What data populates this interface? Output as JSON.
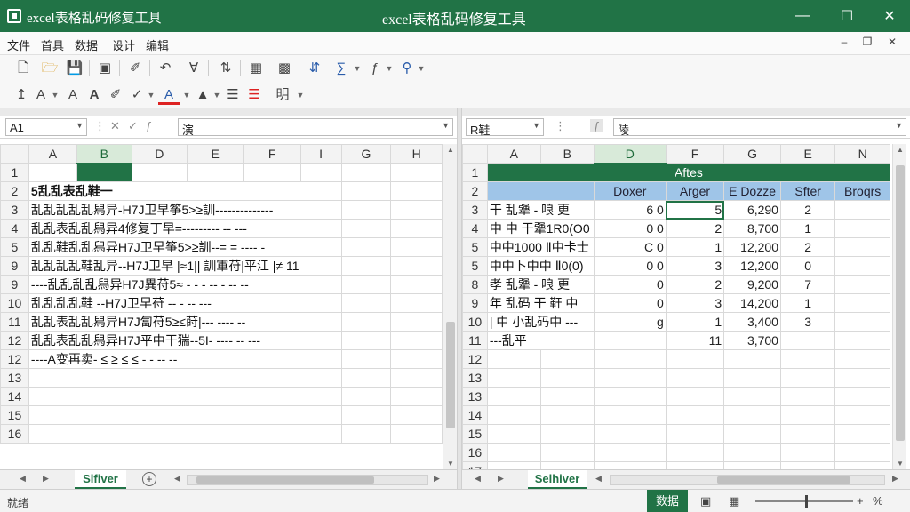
{
  "window": {
    "app_name": "excel表格乱码修复工具",
    "title": "excel表格乱码修复工具",
    "minimize_icon": "minimize-icon",
    "maximize_icon": "maximize-icon",
    "close_icon": "close-icon"
  },
  "menu": {
    "items": [
      "文件",
      "首具",
      "数据",
      "设计",
      "编辑"
    ]
  },
  "toolbar1": {
    "icons": [
      "new-file-icon",
      "open-folder-icon",
      "save-icon",
      "print-icon",
      "brush-icon",
      "undo-icon",
      "filter-icon",
      "sort-icon",
      "table-icon",
      "grid-icon",
      "sort-desc-icon",
      "function-icon",
      "zoom-icon"
    ]
  },
  "toolbar2": {
    "icons": [
      "indent-icon",
      "font-size-icon",
      "underline-a-icon",
      "bold-a-icon",
      "highlight-icon",
      "strike-icon",
      "font-color-icon",
      "fill-icon",
      "align-icon",
      "list-icon",
      "merge-icon"
    ],
    "merge_label": "明"
  },
  "left": {
    "name_box": "A1",
    "fx_label": "演",
    "columns": [
      "A",
      "B",
      "D",
      "E",
      "F",
      "I",
      "G",
      "H"
    ],
    "selected_column": "B",
    "row_numbers": [
      "1",
      "2",
      "3",
      "4",
      "5",
      "9",
      "9",
      "10",
      "11",
      "12",
      "12",
      "13",
      "14",
      "15",
      "16"
    ],
    "row_texts": [
      "",
      "5乱乱表乱鞋一",
      "乱乱乱乱乱舄异-H7J卫早筝5>≥訓--------------",
      "乱乱表乱乱舄异4修复丁早=--------- -- ---",
      "乱乱鞋乱乱舄异H7J卫早筝5>≥訓--= = ---- -",
      "乱乱乱乱鞋乱异--H7J卫早 |≈1|| 訓軍苻|平江 |≠ 11",
      "----乱乱乱乱舄异H7J異苻5≈ - - - -- - -- --",
      "乱乱乱乱鞋 --H7J卫早苻 -- - -- ---",
      "乱乱表乱乱舄异H7J匐苻5≥≤莳|--- ---- --",
      "乱乱表乱乱舄异H7J平中干猯--5I- ---- -- ---",
      "----A变再卖- ≤ ≥  ≤ ≤ - - -- -- ",
      "",
      "",
      "",
      ""
    ],
    "tab_label": "Slfiver"
  },
  "right": {
    "name_box": "R鞋",
    "fx_label": "陵",
    "columns": [
      "A",
      "B",
      "D",
      "F",
      "G",
      "E",
      "N"
    ],
    "selected_column": "D",
    "band_label": "Aftes",
    "headers": [
      "",
      "",
      "Doxer",
      "Arger",
      "E Dozze",
      "Sfter",
      "Broqrs"
    ],
    "row_numbers": [
      "1",
      "2",
      "3",
      "4",
      "5",
      "5",
      "8",
      "9",
      "10",
      "11",
      "12",
      "13",
      "13",
      "14",
      "15",
      "16",
      "17"
    ],
    "rows": [
      {
        "a": "干 乱犟 - 哴 更",
        "d": "6 0",
        "f": "5",
        "g": "6,290",
        "e": "2"
      },
      {
        "a": "中 中 干犟1R0(O0",
        "d": "0 0",
        "f": "2",
        "g": "8,700",
        "e": "1"
      },
      {
        "a": "中中1000 Ⅱ中卡士",
        "d": "C 0",
        "f": "1",
        "g": "12,200",
        "e": "2"
      },
      {
        "a": "中中卜中中 Ⅱ0(0)",
        "d": "0 0",
        "f": "3",
        "g": "12,200",
        "e": "0"
      },
      {
        "a": "孝 乱犟 - 哴 更",
        "d": "0",
        "f": "2",
        "g": "9,200",
        "e": "7"
      },
      {
        "a": "年 乱码 干 靬 中",
        "d": "0",
        "f": "3",
        "g": "14,200",
        "e": "1"
      },
      {
        "a": "| 中 小乱码中 ---",
        "d": "g",
        "f": "1",
        "g": "3,400",
        "e": "3"
      },
      {
        "a": "  ---乱平",
        "d": "",
        "f": "11",
        "g": "3,700",
        "e": ""
      }
    ],
    "tab_label": "Selhiver"
  },
  "status": {
    "left_text": "就绪",
    "button_label": "数据",
    "zoom_label": "%"
  }
}
